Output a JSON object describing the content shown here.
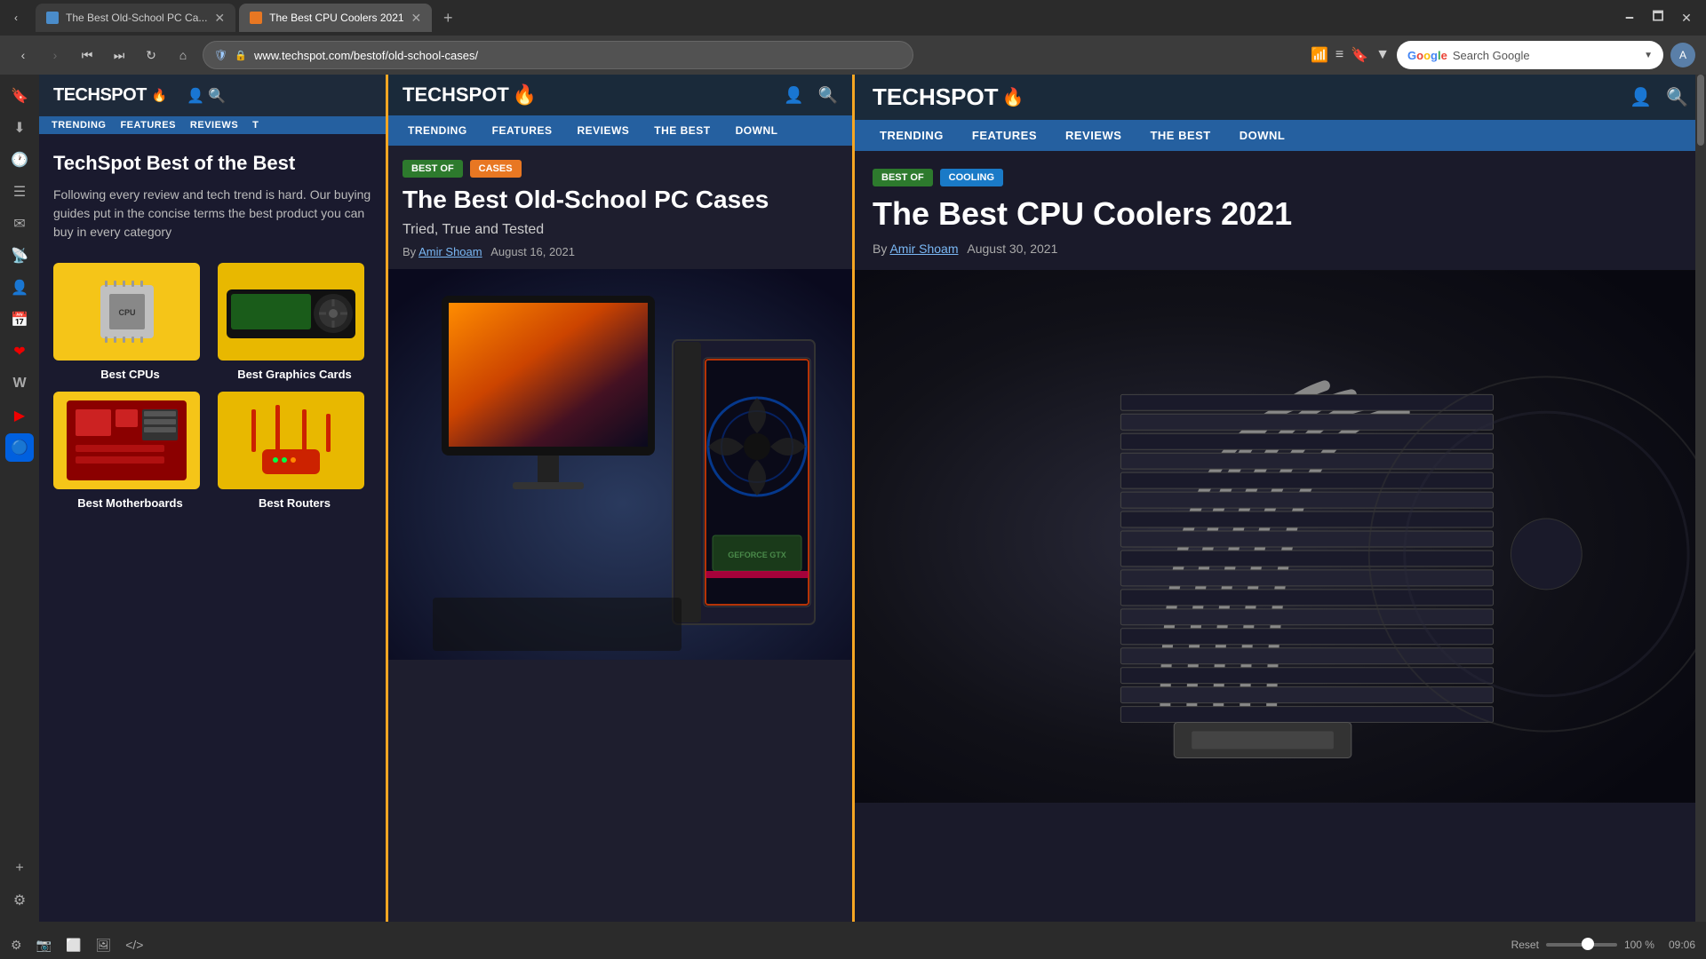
{
  "browser": {
    "tabs": [
      {
        "id": "tab1",
        "title": "The Best Old-School PC Ca...",
        "favicon_color": "blue",
        "active": false
      },
      {
        "id": "tab2",
        "title": "The Best CPU Coolers 2021",
        "favicon_color": "orange",
        "active": true
      }
    ],
    "new_tab_label": "+",
    "window_controls": {
      "minimize": "🗕",
      "maximize": "🗖",
      "close": "✕"
    },
    "nav": {
      "back": "‹",
      "forward": "›",
      "history_back": "⏮",
      "history_forward": "⏭",
      "reload": "↻",
      "home": "⌂"
    },
    "url": "www.techspot.com/bestof/old-school-cases/",
    "shield": "🛡",
    "lock": "🔒",
    "toolbar_icons": [
      "📶",
      "≡",
      "🔖",
      "▼"
    ],
    "search_placeholder": "Search Google",
    "search_dropdown": "▼"
  },
  "sidebar": {
    "icons": [
      {
        "name": "bookmark-icon",
        "symbol": "🔖"
      },
      {
        "name": "download-icon",
        "symbol": "⬇"
      },
      {
        "name": "history-icon",
        "symbol": "🕐"
      },
      {
        "name": "feed-icon",
        "symbol": "☰"
      },
      {
        "name": "mail-icon",
        "symbol": "✉"
      },
      {
        "name": "rss-icon",
        "symbol": "📡"
      },
      {
        "name": "contacts-icon",
        "symbol": "👤"
      },
      {
        "name": "calendar-icon",
        "symbol": "📅"
      },
      {
        "name": "pocket-icon",
        "symbol": "❤"
      },
      {
        "name": "wiki-icon",
        "symbol": "W"
      },
      {
        "name": "youtube-icon",
        "symbol": "▶"
      },
      {
        "name": "firefox-icon",
        "symbol": "🔵"
      },
      {
        "name": "add-icon",
        "symbol": "+"
      },
      {
        "name": "settings-icon",
        "symbol": "⚙"
      }
    ]
  },
  "left_panel": {
    "logo": "TECHSPOT",
    "flame": "🔥",
    "nav_items": [
      "TRENDING",
      "FEATURES",
      "REVIEWS",
      "T"
    ],
    "title": "TechSpot Best of the Best",
    "description": "Following every review and tech trend is hard. Our buying guides put in the concise terms the best product you can buy in every category",
    "grid_items": [
      {
        "label": "Best CPUs",
        "type": "cpu"
      },
      {
        "label": "Best Graphics Cards",
        "type": "gpu"
      },
      {
        "label": "Best Motherboards",
        "type": "motherboard"
      },
      {
        "label": "Best Routers",
        "type": "router"
      }
    ]
  },
  "middle_panel": {
    "logo": "TECHSPOT",
    "flame": "🔥",
    "nav_items": [
      "TRENDING",
      "FEATURES",
      "REVIEWS",
      "THE BEST",
      "DOWNL"
    ],
    "badges": [
      {
        "label": "BEST OF",
        "color": "green"
      },
      {
        "label": "CASES",
        "color": "orange"
      }
    ],
    "article_title": "The Best Old-School PC Cases",
    "article_subtitle": "Tried, True and Tested",
    "article_meta_prefix": "By",
    "article_author": "Amir Shoam",
    "article_date": "August 16, 2021"
  },
  "right_panel": {
    "logo": "TECHSPOT",
    "flame": "🔥",
    "nav_items": [
      "TRENDING",
      "FEATURES",
      "REVIEWS",
      "THE BEST",
      "DOWNL"
    ],
    "badges": [
      {
        "label": "BEST OF",
        "color": "green"
      },
      {
        "label": "COOLING",
        "color": "blue"
      }
    ],
    "article_title": "The Best CPU Coolers 2021",
    "article_meta_prefix": "By",
    "article_author": "Amir Shoam",
    "article_date": "August 30, 2021"
  },
  "status_bar": {
    "icons": [
      "📷",
      "⬜",
      "🖼",
      "</>"
    ],
    "reset_label": "Reset",
    "zoom_percent": "100 %",
    "time": "09:06"
  }
}
